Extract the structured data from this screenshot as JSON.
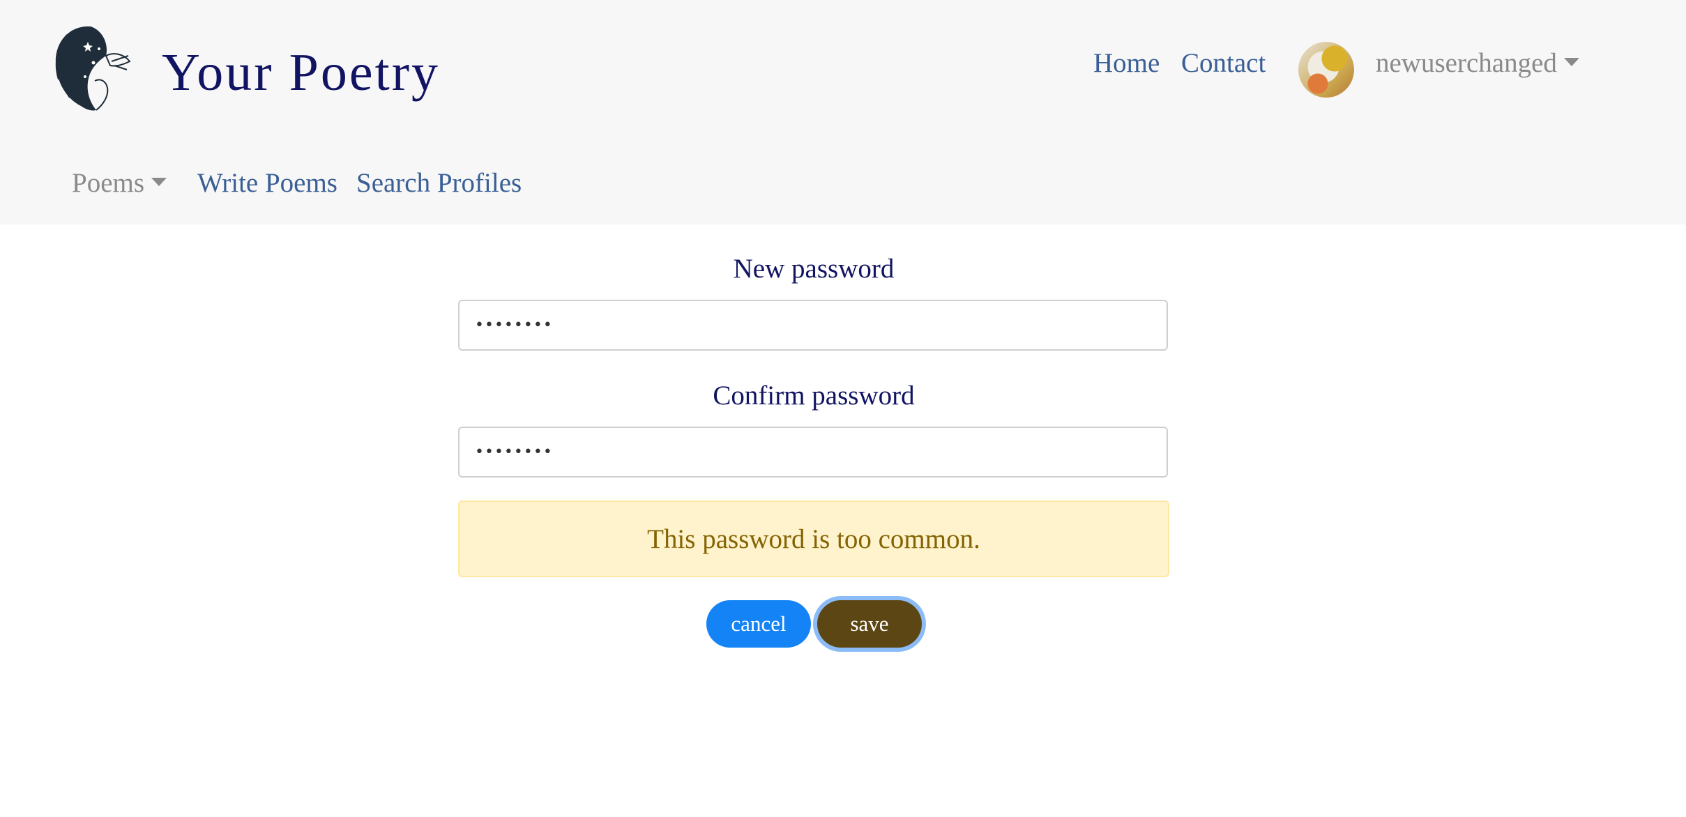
{
  "header": {
    "brand": "Your Poetry",
    "logo_icon": "woman-face-logo-icon",
    "nav": {
      "home": "Home",
      "contact": "Contact"
    },
    "user": {
      "name": "newuserchanged",
      "avatar_icon": "avatar-image"
    }
  },
  "subnav": {
    "poems": "Poems",
    "write_poems": "Write Poems",
    "search_profiles": "Search Profiles"
  },
  "form": {
    "new_password_label": "New password",
    "new_password_value": "••••••••",
    "confirm_password_label": "Confirm password",
    "confirm_password_value": "••••••••",
    "alert": "This password is too common.",
    "cancel_label": "cancel",
    "save_label": "save"
  },
  "colors": {
    "brand": "#111462",
    "link": "#3a5f95",
    "alert_bg": "#fff3cd",
    "alert_text": "#856404",
    "cancel_button": "#1383f5",
    "save_button": "#5c4613"
  }
}
